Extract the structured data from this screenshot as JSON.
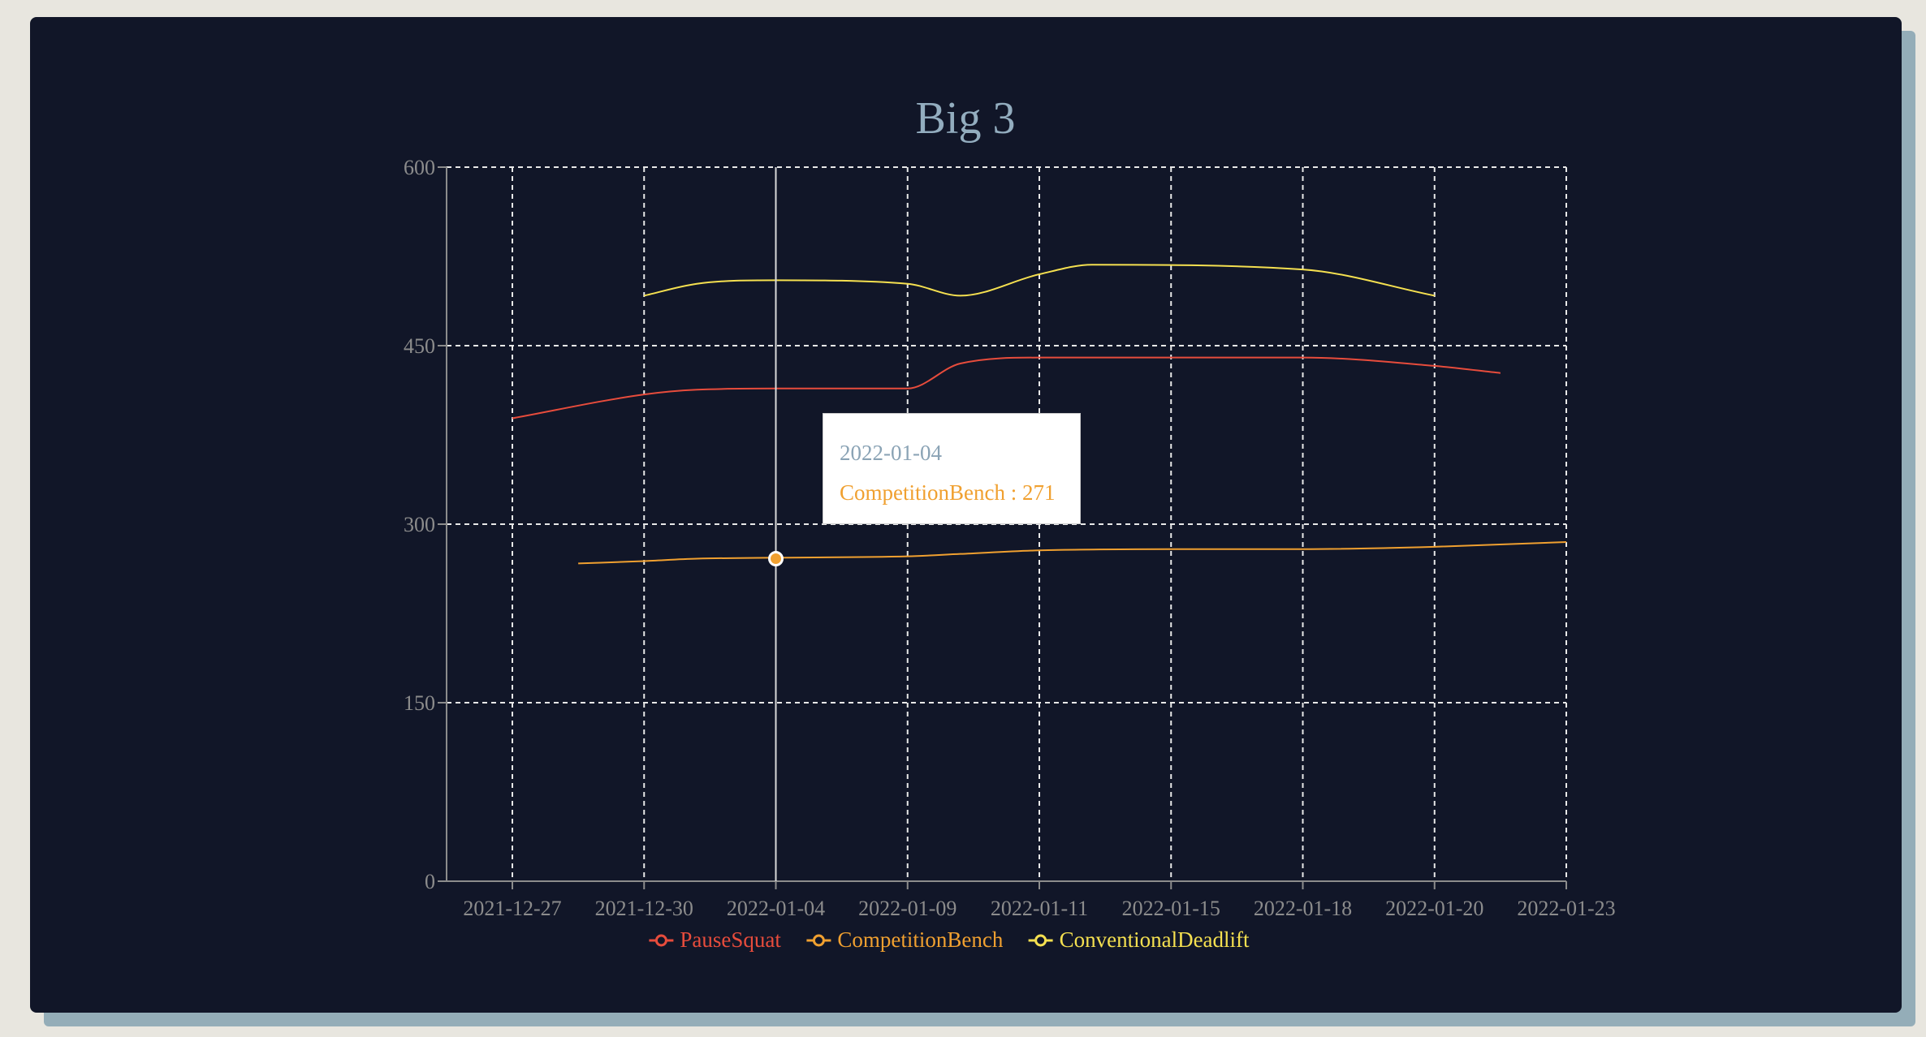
{
  "colors": {
    "background": "#111628",
    "title": "#93adbf",
    "grid": "#e8e8e8",
    "axis": "#8c8c8c",
    "pause_squat": "#e74c3c",
    "competition_bench": "#f0a030",
    "conventional_deadlift": "#f5e050"
  },
  "tooltip": {
    "date": "2022-01-04",
    "series_name": "CompetitionBench",
    "separator": " : ",
    "value": "271"
  },
  "chart_data": {
    "type": "line",
    "title": "Big 3",
    "xlabel": "",
    "ylabel": "",
    "categories": [
      "2021-12-27",
      "2021-12-30",
      "2022-01-04",
      "2022-01-09",
      "2022-01-11",
      "2022-01-15",
      "2022-01-18",
      "2022-01-20",
      "2022-01-23"
    ],
    "x_points": [
      0,
      0.5,
      1,
      1.4,
      2,
      3,
      3.4,
      4,
      4.4,
      5,
      6,
      7,
      7.5,
      8
    ],
    "ylim": [
      0,
      600
    ],
    "yticks": [
      0,
      150,
      300,
      450,
      600
    ],
    "grid": true,
    "legend_position": "bottom",
    "active_point": {
      "series": 1,
      "category": "2022-01-04",
      "value": 271
    },
    "series": [
      {
        "name": "PauseSquat",
        "color": "#e74c3c",
        "values": [
          389,
          null,
          409,
          413,
          414,
          414,
          435,
          440,
          null,
          440,
          440,
          433,
          427,
          null
        ]
      },
      {
        "name": "CompetitionBench",
        "color": "#f0a030",
        "values": [
          null,
          267,
          269,
          271,
          null,
          273,
          275,
          278,
          null,
          279,
          279,
          281,
          null,
          285
        ]
      },
      {
        "name": "ConventionalDeadlift",
        "color": "#f5e050",
        "values": [
          null,
          null,
          492,
          502,
          505,
          502,
          492,
          510,
          518,
          null,
          514,
          492,
          null,
          null
        ]
      }
    ]
  }
}
